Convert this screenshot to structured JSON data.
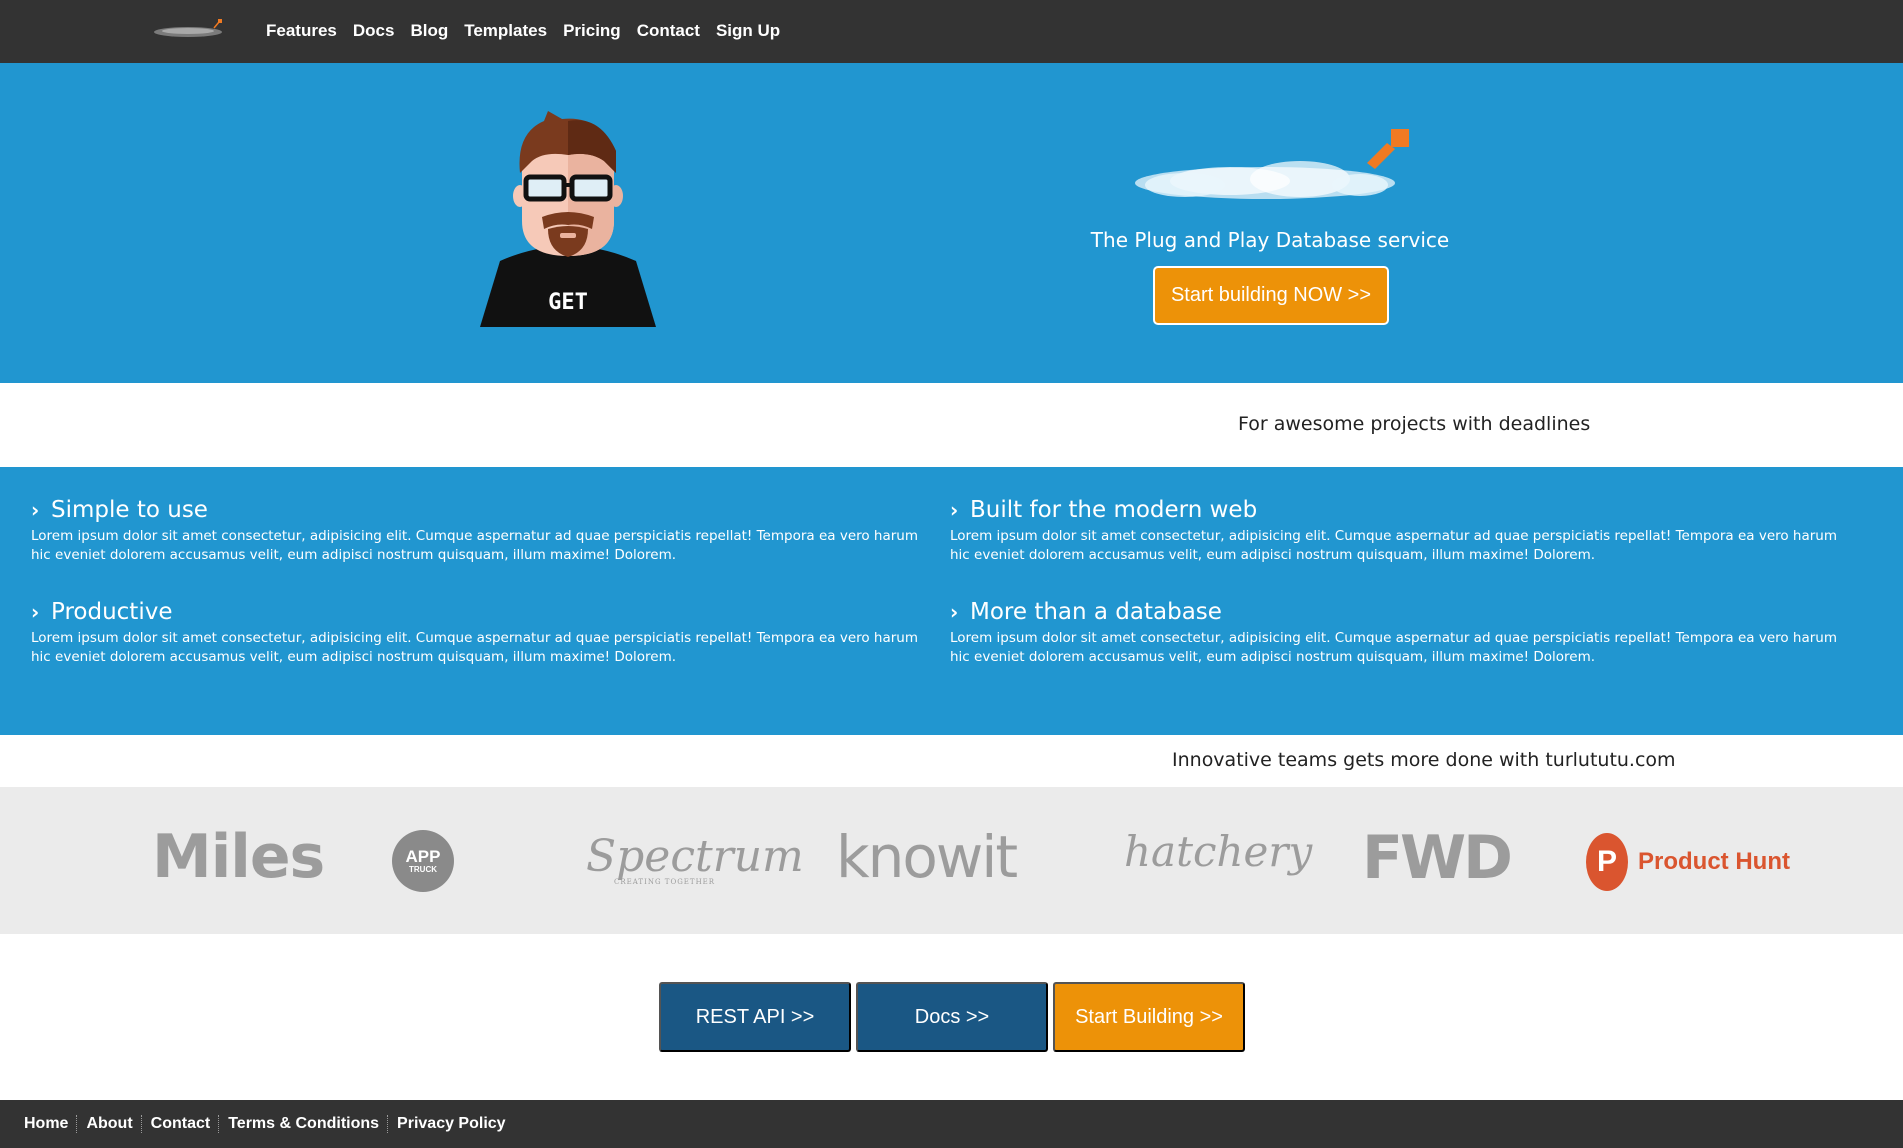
{
  "nav": {
    "logo_icon": "turlututu-logo-icon",
    "items": [
      {
        "label": "Features"
      },
      {
        "label": "Docs"
      },
      {
        "label": "Blog"
      },
      {
        "label": "Templates"
      },
      {
        "label": "Pricing"
      },
      {
        "label": "Contact"
      },
      {
        "label": "Sign Up"
      }
    ]
  },
  "hero": {
    "avatar_shirt_text": "GET",
    "tagline": "The Plug and Play Database service",
    "cta_label": "Start building NOW >>",
    "colors": {
      "background": "#2196d0",
      "cta": "#ed9208"
    }
  },
  "subtitle": "For awesome projects with deadlines",
  "features": [
    {
      "title": "Simple to use",
      "text": "Lorem ipsum dolor sit amet consectetur, adipisicing elit. Cumque aspernatur ad quae perspiciatis repellat! Tempora ea vero harum hic eveniet dolorem accusamus velit, eum adipisci nostrum quisquam, illum maxime! Dolorem."
    },
    {
      "title": "Built for the modern web",
      "text": "Lorem ipsum dolor sit amet consectetur, adipisicing elit. Cumque aspernatur ad quae perspiciatis repellat! Tempora ea vero harum hic eveniet dolorem accusamus velit, eum adipisci nostrum quisquam, illum maxime! Dolorem."
    },
    {
      "title": "Productive",
      "text": "Lorem ipsum dolor sit amet consectetur, adipisicing elit. Cumque aspernatur ad quae perspiciatis repellat! Tempora ea vero harum hic eveniet dolorem accusamus velit, eum adipisci nostrum quisquam, illum maxime! Dolorem."
    },
    {
      "title": "More than a database",
      "text": "Lorem ipsum dolor sit amet consectetur, adipisicing elit. Cumque aspernatur ad quae perspiciatis repellat! Tempora ea vero harum hic eveniet dolorem accusamus velit, eum adipisci nostrum quisquam, illum maxime! Dolorem."
    }
  ],
  "teams_text": "Innovative teams gets more done with turlututu.com",
  "client_logos": {
    "miles": "Miles",
    "apptruck_1": "APP",
    "apptruck_2": "TRUCK",
    "spectrum": "Spectrum",
    "spectrum_sub": "CREATING TOGETHER",
    "knowit": "knowit",
    "hatchery": "hatchery",
    "fwd": "FWD",
    "producthunt_letter": "P",
    "producthunt": "Product Hunt"
  },
  "buttons": {
    "rest_api": "REST API >>",
    "docs": "Docs >>",
    "start_building": "Start Building >>"
  },
  "footer": {
    "items": [
      {
        "label": "Home"
      },
      {
        "label": "About"
      },
      {
        "label": "Contact"
      },
      {
        "label": "Terms & Conditions"
      },
      {
        "label": "Privacy Policy"
      }
    ]
  }
}
